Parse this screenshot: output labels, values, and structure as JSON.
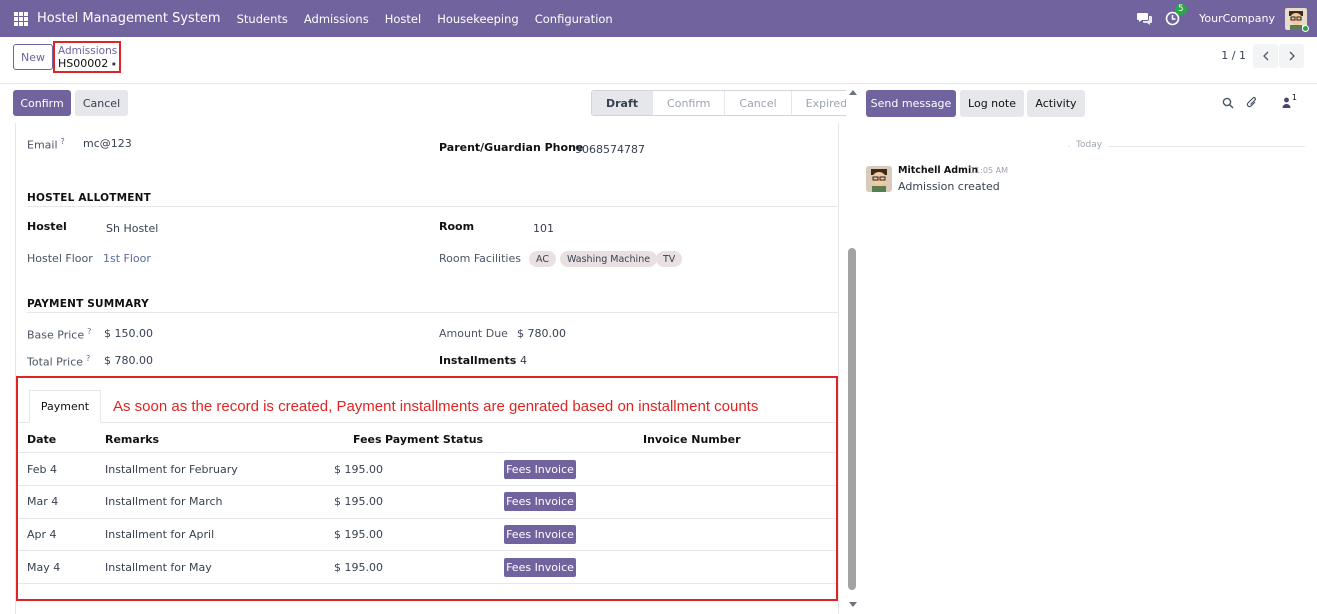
{
  "navbar": {
    "app_title": "Hostel Management System",
    "menu": [
      "Students",
      "Admissions",
      "Hostel",
      "Housekeeping",
      "Configuration"
    ],
    "activity_badge": "5",
    "company": "YourCompany"
  },
  "control_panel": {
    "new_label": "New",
    "breadcrumb_parent": "Admissions",
    "breadcrumb_current": "HS00002",
    "pager": "1 / 1"
  },
  "statusbar": {
    "confirm_label": "Confirm",
    "cancel_label": "Cancel",
    "stages": [
      "Draft",
      "Confirm",
      "Cancel",
      "Expired"
    ],
    "active_stage": "Draft"
  },
  "form": {
    "email_label": "Email",
    "email_value": "mc@123",
    "guardian_phone_label": "Parent/Guardian Phone",
    "guardian_phone_value": "9068574787",
    "hostel_allotment": {
      "title": "HOSTEL ALLOTMENT",
      "hostel_label": "Hostel",
      "hostel_value": "Sh Hostel",
      "room_label": "Room",
      "room_value": "101",
      "floor_label": "Hostel Floor",
      "floor_value": "1st Floor",
      "facilities_label": "Room Facilities",
      "facilities": [
        "AC",
        "Washing Machine",
        "TV"
      ]
    },
    "payment_summary": {
      "title": "PAYMENT SUMMARY",
      "base_price_label": "Base Price",
      "base_price_value": "$ 150.00",
      "amount_due_label": "Amount Due",
      "amount_due_value": "$ 780.00",
      "total_price_label": "Total Price",
      "total_price_value": "$ 780.00",
      "installments_label": "Installments",
      "installments_value": "4"
    },
    "payment_tab": {
      "tab_label": "Payment",
      "annotation": "As soon as the record is created, Payment installments are genrated based on installment counts",
      "columns": [
        "Date",
        "Remarks",
        "Fees",
        "Payment Status",
        "Invoice Number"
      ],
      "rows": [
        {
          "date": "Feb 4",
          "remarks": "Installment for February",
          "fees": "$ 195.00",
          "button": "Fees Invoice"
        },
        {
          "date": "Mar 4",
          "remarks": "Installment for March",
          "fees": "$ 195.00",
          "button": "Fees Invoice"
        },
        {
          "date": "Apr 4",
          "remarks": "Installment for April",
          "fees": "$ 195.00",
          "button": "Fees Invoice"
        },
        {
          "date": "May 4",
          "remarks": "Installment for May",
          "fees": "$ 195.00",
          "button": "Fees Invoice"
        }
      ]
    }
  },
  "chatter": {
    "send_message_label": "Send message",
    "log_note_label": "Log note",
    "activity_label": "Activity",
    "followers_count": "1",
    "separator_label": "Today",
    "message": {
      "author": "Mitchell Admin",
      "time": "11:05 AM",
      "body": "Admission created"
    }
  },
  "colors": {
    "brand": "#71639e",
    "highlight": "#e02424"
  }
}
